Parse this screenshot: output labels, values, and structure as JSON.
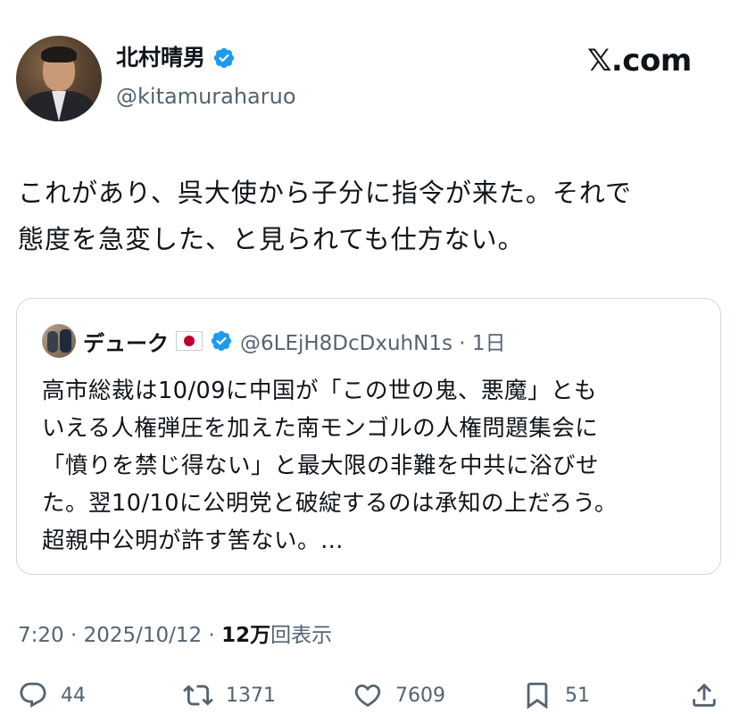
{
  "author": {
    "name": "北村晴男",
    "handle": "@kitamuraharuo",
    "verified": true
  },
  "brand": {
    "logo_text": "𝕏.com"
  },
  "tweet": {
    "text": "これがあり、呉大使から子分に指令が来た。それで\n態度を急変した、と見られても仕方ない。"
  },
  "quote": {
    "name": "デューク",
    "flag": "Japan",
    "verified": true,
    "handle_time": "@6LEjH8DcDxuhN1s · 1日",
    "text": "高市総裁は10/09に中国が「この世の鬼、悪魔」とも\nいえる人権弾圧を加えた南モンゴルの人権問題集会に\n「憤りを禁じ得ない」と最大限の非難を中共に浴びせ\nた。翌10/10に公明党と破綻するのは承知の上だろう。\n超親中公明が許す筈ない。…"
  },
  "meta": {
    "time": "7:20 · 2025/10/12 · ",
    "views_count": "12万",
    "views_label": "回表示"
  },
  "actions": {
    "replies": "44",
    "reposts": "1371",
    "likes": "7609",
    "bookmarks": "51"
  },
  "colors": {
    "text": "#0f1419",
    "secondary": "#536471",
    "verified": "#1d9bf0",
    "border": "#cfd9de"
  },
  "icons": [
    "verified-badge-icon",
    "reply-icon",
    "repost-icon",
    "like-icon",
    "bookmark-icon",
    "share-icon"
  ]
}
